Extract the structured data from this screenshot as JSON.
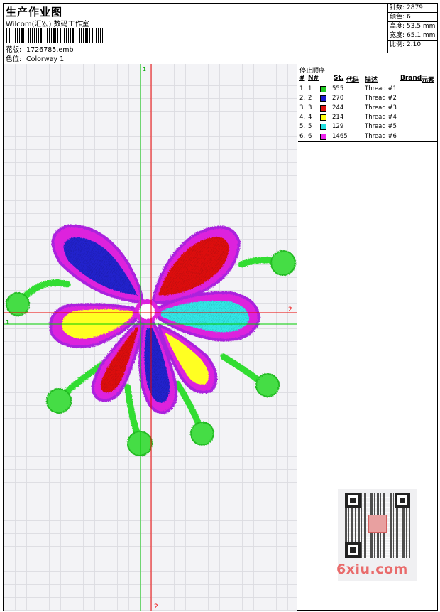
{
  "header": {
    "title": "生产作业图",
    "company": "Wilcom(汇宏) 数码工作室",
    "design_label": "花版:",
    "design_file": "1726785.emb",
    "colorway_label": "色位:",
    "colorway": "Colorway 1"
  },
  "stats": [
    {
      "label": "针数:",
      "value": "2879"
    },
    {
      "label": "颜色:",
      "value": "6"
    },
    {
      "label": "高度:",
      "value": "53.5 mm"
    },
    {
      "label": "宽度:",
      "value": "65.1 mm"
    },
    {
      "label": "比例:",
      "value": "2.10"
    }
  ],
  "axes": {
    "v_green": "1",
    "h_red": "2",
    "h_green": "1",
    "v_red": "2"
  },
  "threads": {
    "title": "停止顺序:",
    "columns": {
      "num": "#",
      "n": "N#",
      "st": "St.",
      "code": "代码",
      "desc": "描述",
      "brand": "Brand",
      "elem": "元素"
    },
    "rows": [
      {
        "num": "1.",
        "n": "1",
        "st": "555",
        "color": "#22cc22",
        "desc": "Thread #1"
      },
      {
        "num": "2.",
        "n": "2",
        "st": "270",
        "color": "#1a1acc",
        "desc": "Thread #2"
      },
      {
        "num": "3.",
        "n": "3",
        "st": "244",
        "color": "#dd1111",
        "desc": "Thread #3"
      },
      {
        "num": "4.",
        "n": "4",
        "st": "214",
        "color": "#ffff11",
        "desc": "Thread #4"
      },
      {
        "num": "5.",
        "n": "5",
        "st": "129",
        "color": "#22e0e0",
        "desc": "Thread #5"
      },
      {
        "num": "6.",
        "n": "6",
        "st": "1465",
        "color": "#ee22ee",
        "desc": "Thread #6"
      }
    ]
  },
  "watermark": {
    "brand": "6xiu.com"
  }
}
